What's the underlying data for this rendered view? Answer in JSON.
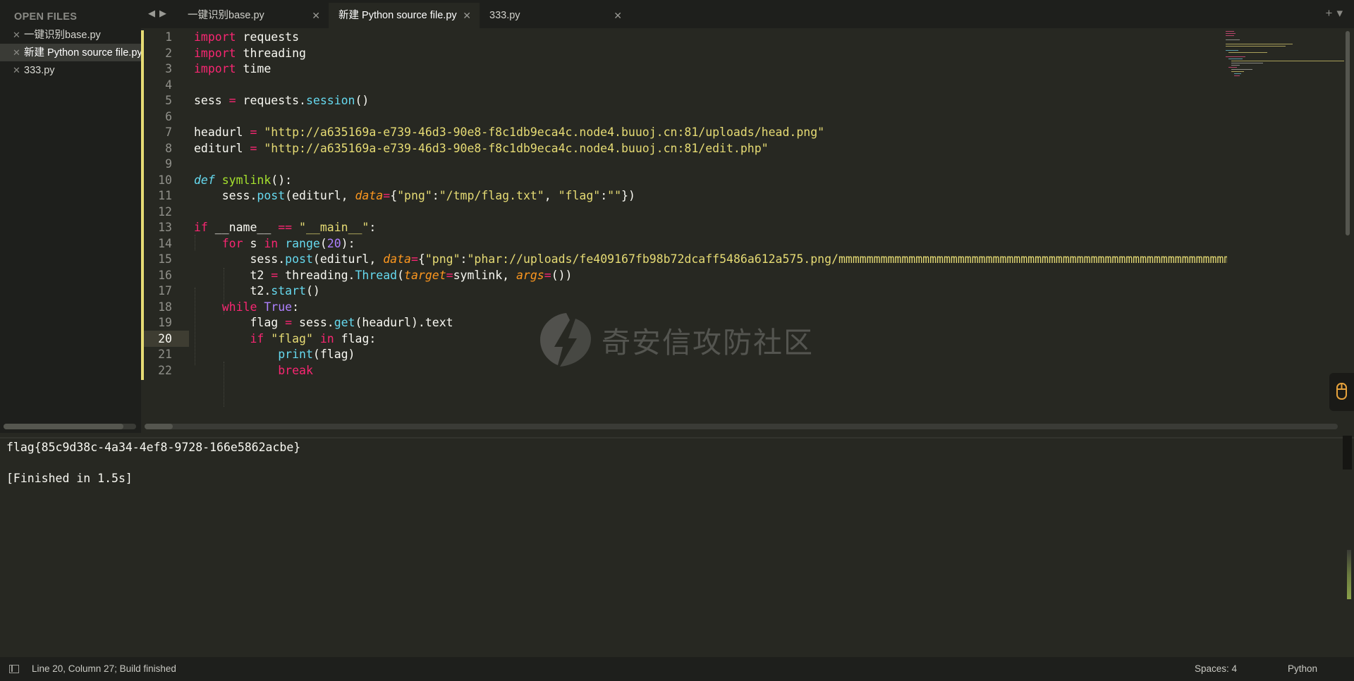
{
  "sidebar": {
    "title": "OPEN FILES",
    "close_glyph": "✕",
    "files": [
      {
        "name": "一键识别base.py",
        "active": false
      },
      {
        "name": "新建 Python source file.py",
        "active": true
      },
      {
        "name": "333.py",
        "active": false
      }
    ]
  },
  "tabs": {
    "nav_back": "◀",
    "nav_forward": "▶",
    "close_glyph": "✕",
    "items": [
      {
        "label": "一键识别base.py",
        "active": false
      },
      {
        "label": "新建 Python source file.py",
        "active": true
      },
      {
        "label": "333.py",
        "active": false
      }
    ],
    "new_tab": "+",
    "menu": "▾"
  },
  "editor": {
    "current_line": 20,
    "line_numbers": [
      "1",
      "2",
      "3",
      "4",
      "5",
      "6",
      "7",
      "8",
      "9",
      "10",
      "11",
      "12",
      "13",
      "14",
      "15",
      "16",
      "17",
      "18",
      "19",
      "20",
      "21",
      "22"
    ]
  },
  "output": {
    "lines": [
      "flag{85c9d38c-4a34-4ef8-9728-166e5862acbe}",
      "",
      "[Finished in 1.5s]"
    ]
  },
  "status": {
    "position": "Line 20, Column 27; Build finished",
    "spaces": "Spaces: 4",
    "syntax": "Python"
  },
  "watermark": {
    "text": "奇安信攻防社区"
  },
  "colors": {
    "background": "#272822",
    "keyword": "#f92672",
    "function": "#66d9ef",
    "string": "#e6db74",
    "def_name": "#a6e22e",
    "param": "#fd971f",
    "number": "#ae81ff"
  },
  "icons": [
    "close-icon",
    "back-arrow-icon",
    "forward-arrow-icon",
    "new-tab-icon",
    "tab-menu-icon",
    "panel-toggle-icon"
  ]
}
